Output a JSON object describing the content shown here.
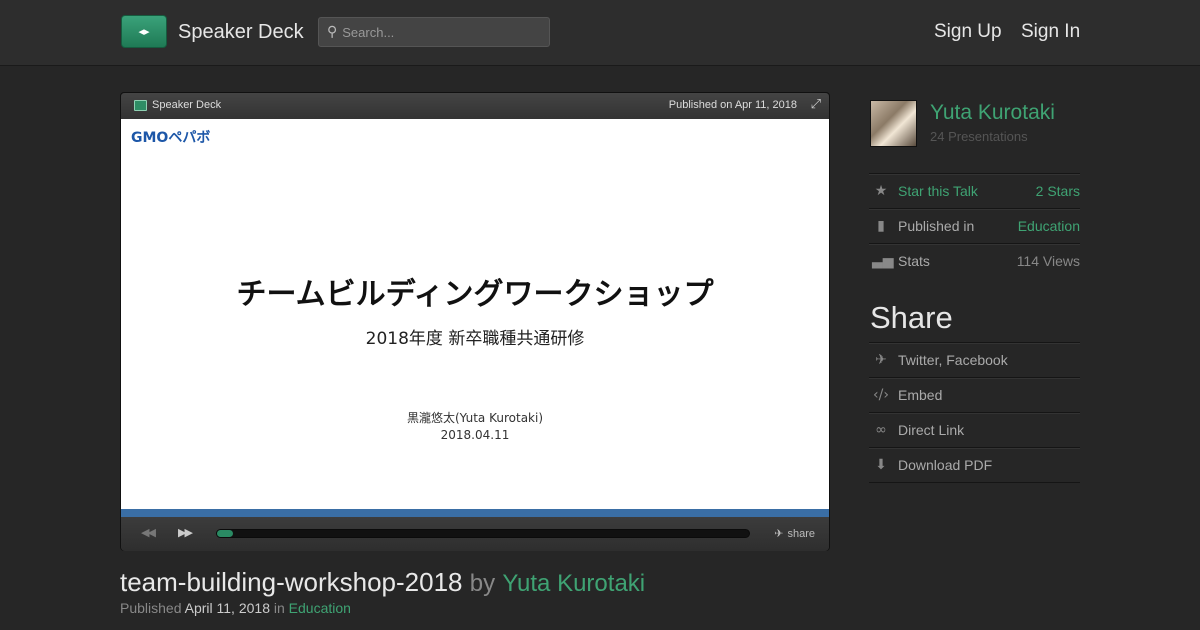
{
  "header": {
    "brand": "Speaker Deck",
    "search_placeholder": "Search...",
    "sign_up": "Sign Up",
    "sign_in": "Sign In"
  },
  "player": {
    "brand": "Speaker Deck",
    "published_on": "Published on Apr 11, 2018",
    "share_label": "share",
    "progress_percent": 3
  },
  "slide": {
    "logo_text": "GMOペパボ",
    "title": "チームビルディングワークショップ",
    "subtitle": "2018年度 新卒職種共通研修",
    "author": "黒瀧悠太(Yuta Kurotaki)",
    "date": "2018.04.11"
  },
  "talk": {
    "title": "team-building-workshop-2018",
    "by": "by",
    "author": "Yuta Kurotaki",
    "published_label": "Published",
    "published_date": "April 11, 2018",
    "in_label": "in",
    "category": "Education"
  },
  "sidebar": {
    "author_name": "Yuta Kurotaki",
    "presentations": "24 Presentations",
    "stats_rows": [
      {
        "label": "Star this Talk",
        "value": "2 Stars",
        "icon": "star-icon"
      },
      {
        "label": "Published in",
        "value": "Education",
        "icon": "bookmark-icon"
      },
      {
        "label": "Stats",
        "value": "114 Views",
        "icon": "bar-chart-icon"
      }
    ],
    "share_heading": "Share",
    "share_rows": [
      {
        "label": "Twitter, Facebook",
        "icon": "twitter-icon"
      },
      {
        "label": "Embed",
        "icon": "code-icon"
      },
      {
        "label": "Direct Link",
        "icon": "link-icon"
      },
      {
        "label": "Download PDF",
        "icon": "download-icon"
      }
    ]
  },
  "colors": {
    "accent_green": "#3fa373",
    "background": "#262626",
    "slide_bar": "#3a6ea5"
  }
}
